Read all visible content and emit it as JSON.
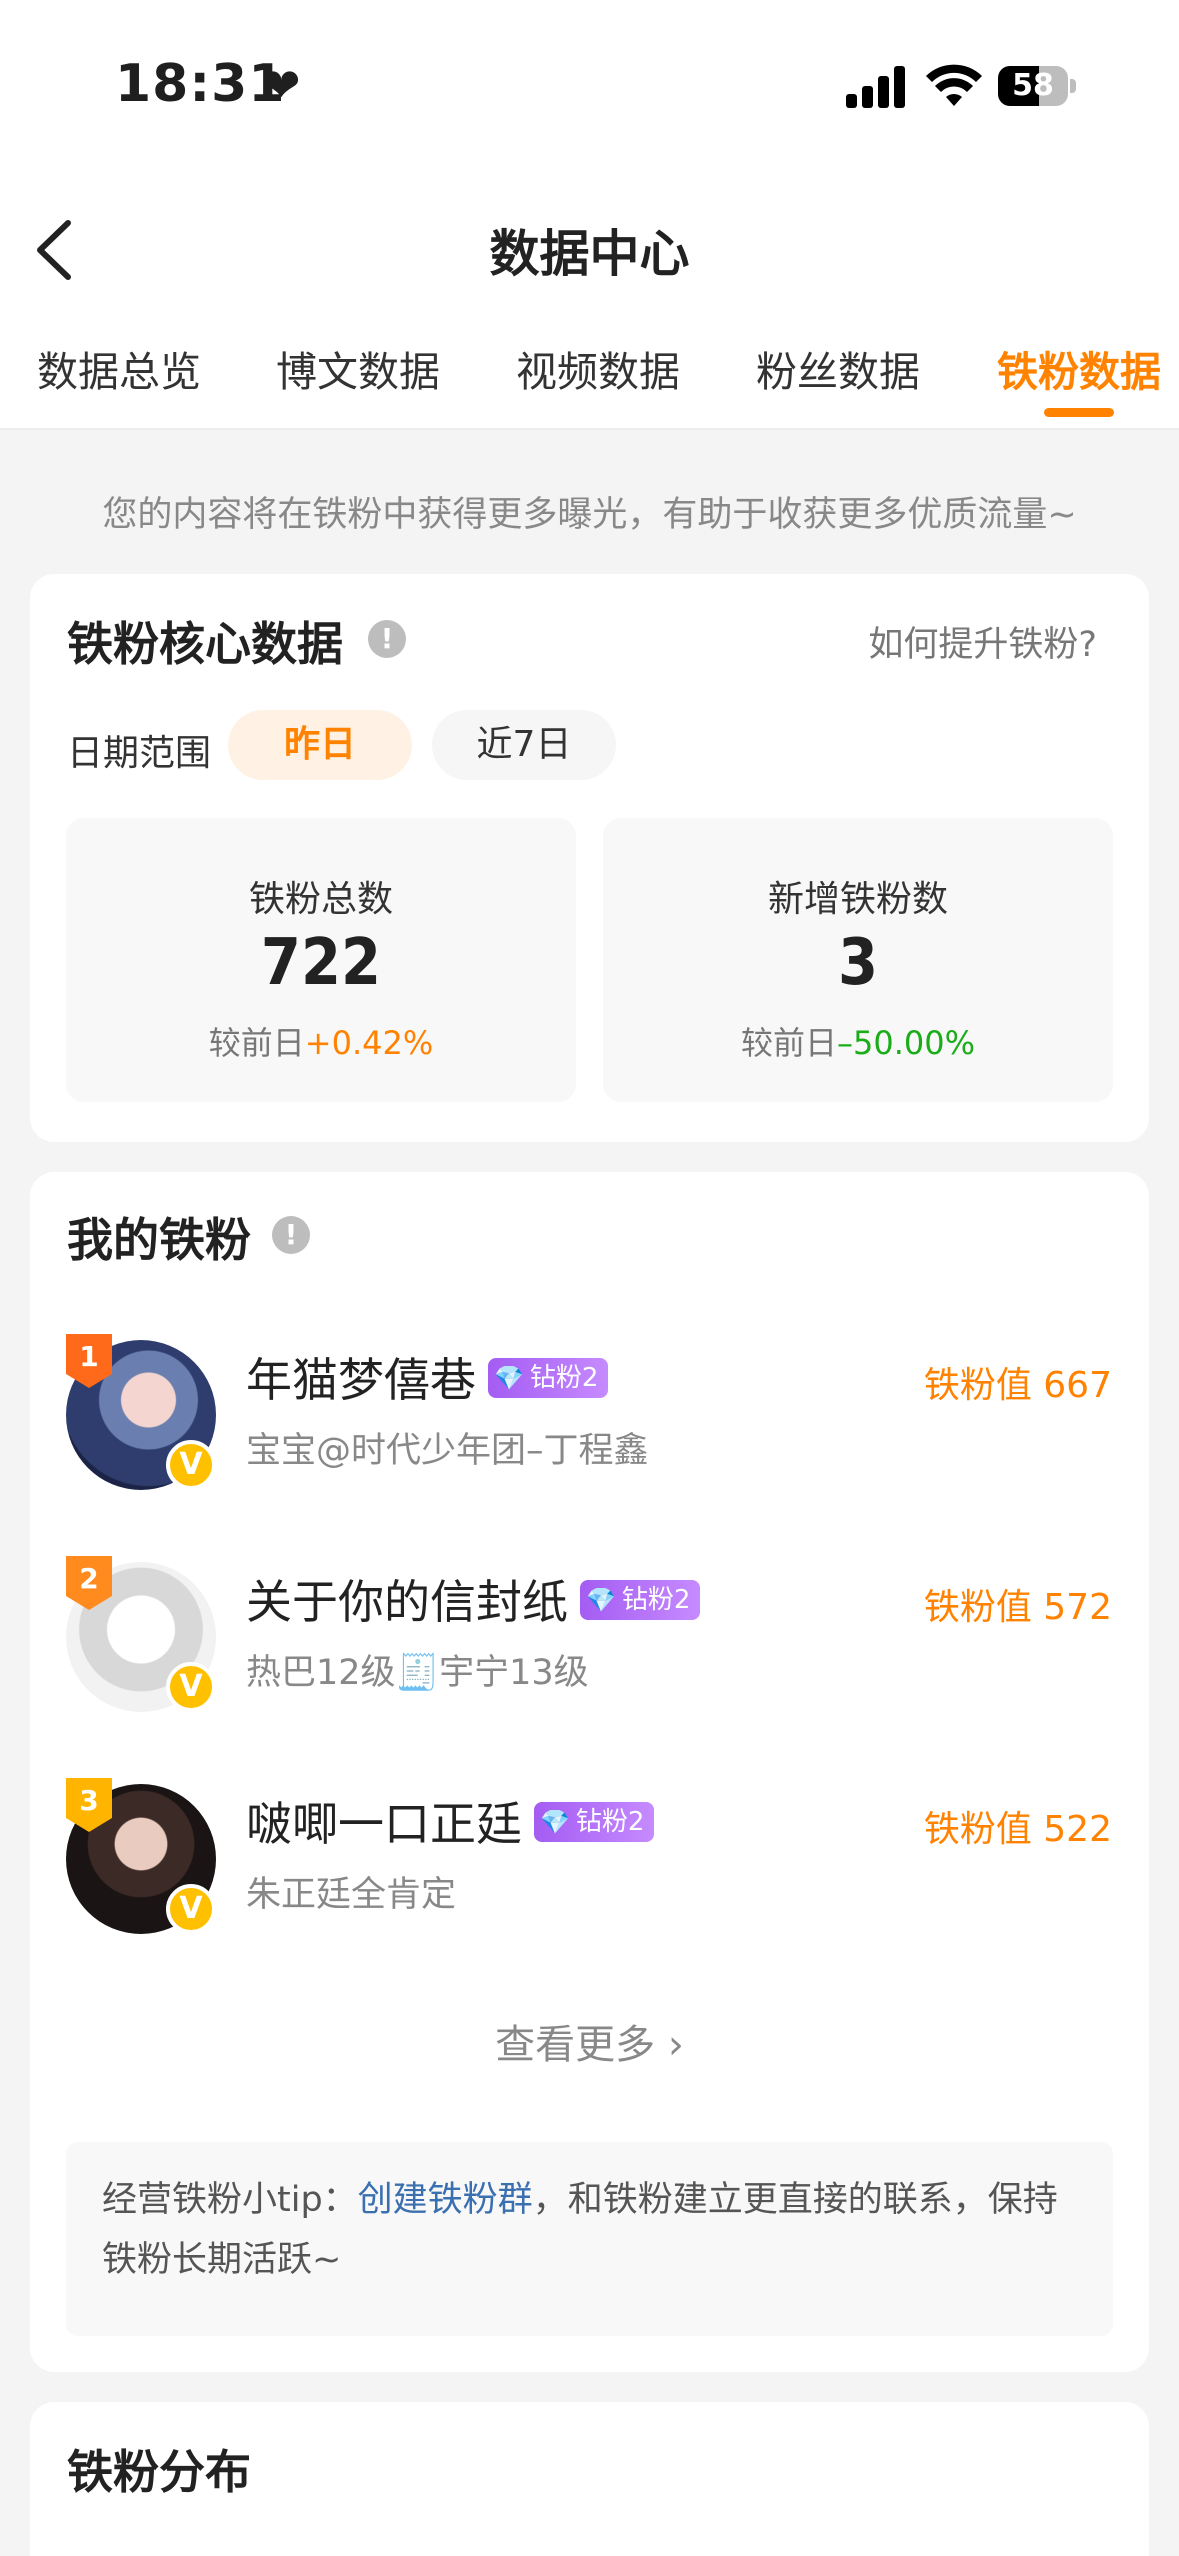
{
  "status": {
    "time": "18:31",
    "battery": "58",
    "battery_level": 0.58
  },
  "nav": {
    "title": "数据中心"
  },
  "tabs": [
    {
      "label": "数据总览"
    },
    {
      "label": "博文数据"
    },
    {
      "label": "视频数据"
    },
    {
      "label": "粉丝数据"
    },
    {
      "label": "铁粉数据"
    }
  ],
  "active_tab_index": 4,
  "notice": "您的内容将在铁粉中获得更多曝光，有助于收获更多优质流量~",
  "core": {
    "title": "铁粉核心数据",
    "help_link": "如何提升铁粉?",
    "date_label": "日期范围",
    "date_options": [
      "昨日",
      "近7日"
    ],
    "stats": [
      {
        "label": "铁粉总数",
        "value": "722",
        "compare_label": "较前日",
        "change": "+0.42%"
      },
      {
        "label": "新增铁粉数",
        "value": "3",
        "compare_label": "较前日",
        "change": "–50.00%"
      }
    ]
  },
  "my_fans": {
    "title": "我的铁粉",
    "badge_label": "钻粉2",
    "score_label": "铁粉值",
    "fans": [
      {
        "rank": "1",
        "name": "年猫梦僖巷",
        "sub": "宝宝@时代少年团–丁程鑫",
        "score": "667"
      },
      {
        "rank": "2",
        "name": "关于你的信封纸",
        "sub": "热巴12级🧾宇宁13级",
        "score": "572"
      },
      {
        "rank": "3",
        "name": "啵唧一口正廷",
        "sub": "朱正廷全肯定",
        "score": "522"
      }
    ],
    "more": "查看更多",
    "tip_prefix": "经营铁粉小tip：",
    "tip_link": "创建铁粉群",
    "tip_suffix": "，和铁粉建立更直接的联系，保持铁粉长期活跃~"
  },
  "distribution": {
    "title": "铁粉分布"
  },
  "colors": {
    "accent": "#ff8200",
    "up": "#ff8200",
    "down": "#1aad19",
    "link": "#3a6fb0"
  }
}
